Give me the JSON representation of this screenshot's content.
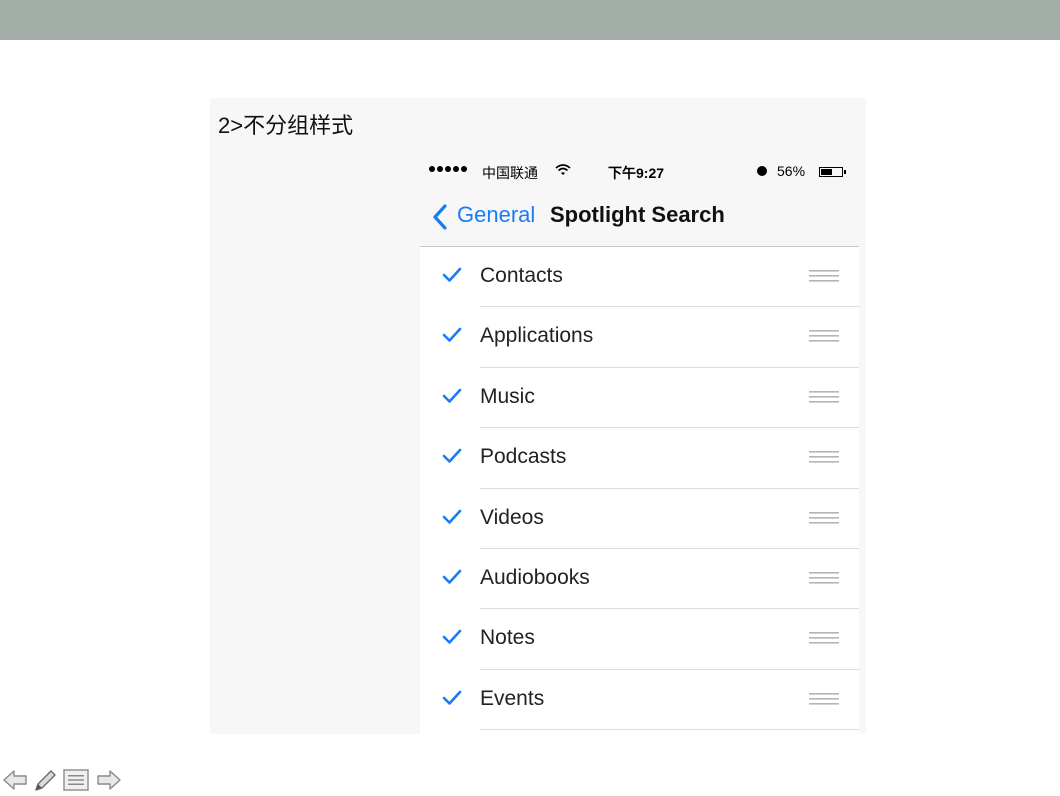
{
  "slide": {
    "heading": "2>不分组样式"
  },
  "status_bar": {
    "carrier": "中国联通",
    "time": "下午9:27",
    "battery_percent": "56%",
    "battery_level": 0.56,
    "signal_icon": "signal-dots-icon",
    "wifi_icon": "wifi-icon",
    "alarm_icon": "alarm-icon"
  },
  "nav_bar": {
    "back_label": "General",
    "title": "Spotlight Search",
    "back_icon": "chevron-left-icon"
  },
  "list": {
    "items": [
      {
        "label": "Contacts",
        "checked": true
      },
      {
        "label": "Applications",
        "checked": true
      },
      {
        "label": "Music",
        "checked": true
      },
      {
        "label": "Podcasts",
        "checked": true
      },
      {
        "label": "Videos",
        "checked": true
      },
      {
        "label": "Audiobooks",
        "checked": true
      },
      {
        "label": "Notes",
        "checked": true
      },
      {
        "label": "Events",
        "checked": true
      }
    ],
    "check_icon": "checkmark-icon",
    "reorder_icon": "reorder-grip-icon"
  },
  "controls": {
    "prev_icon": "arrow-left-icon",
    "pen_icon": "pen-icon",
    "menu_icon": "menu-icon",
    "next_icon": "arrow-right-icon"
  },
  "colors": {
    "accent": "#1a7cf5",
    "top_band": "#a3aea8",
    "separator": "#dcdcdc"
  }
}
